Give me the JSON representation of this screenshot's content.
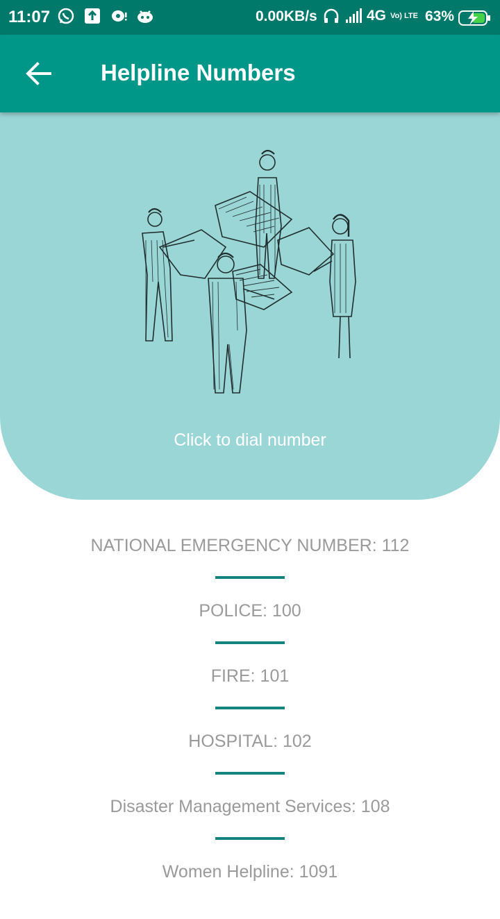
{
  "status_bar": {
    "time": "11:07",
    "net_speed": "0.00KB/s",
    "network": "4G",
    "volte": "Vo) LTE",
    "battery": "63%"
  },
  "app_bar": {
    "title": "Helpline Numbers",
    "back_icon": "arrow-left-icon"
  },
  "hero": {
    "hint": "Click to dial number"
  },
  "helplines": [
    {
      "label": "NATIONAL EMERGENCY NUMBER: 112"
    },
    {
      "label": "POLICE: 100"
    },
    {
      "label": "FIRE: 101"
    },
    {
      "label": "HOSPITAL: 102"
    },
    {
      "label": "Disaster Management Services: 108"
    },
    {
      "label": "Women Helpline: 1091"
    }
  ],
  "colors": {
    "status_bar": "#00796b",
    "app_bar": "#009688",
    "hero_bg": "#9bd6d7",
    "divider": "#14847f",
    "item_text": "#9a9a9a"
  }
}
